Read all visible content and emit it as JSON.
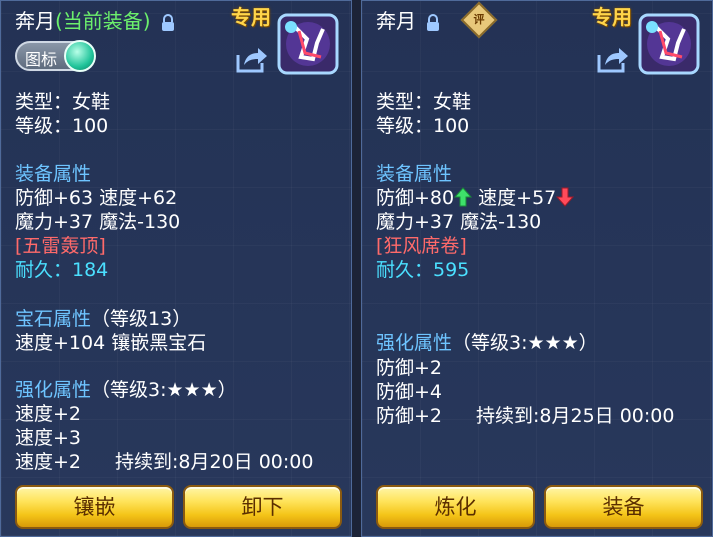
{
  "left": {
    "title": "奔月",
    "title_status": "(当前装备)",
    "exclusive": "专用",
    "toggle_label": "图标",
    "type": "类型：女鞋",
    "level": "等级：100",
    "equip_attr_title": "装备属性",
    "attr_line1": "防御+63 速度+62",
    "attr_line2": "魔力+37 魔法-130",
    "special": "[五雷轰顶]",
    "durability": "耐久：184",
    "gem_title": "宝石属性",
    "gem_level": "（等级13）",
    "gem_line": "速度+104 镶嵌黑宝石",
    "enhance_title": "强化属性",
    "enhance_level": "（等级3:★★★）",
    "enhance_lines": [
      "速度+2",
      "速度+3",
      "速度+2"
    ],
    "enhance_duration": "持续到:8月20日 00:00",
    "buttons": [
      "镶嵌",
      "卸下"
    ]
  },
  "right": {
    "title": "奔月",
    "rate_badge": "评",
    "exclusive": "专用",
    "type": "类型：女鞋",
    "level": "等级：100",
    "equip_attr_title": "装备属性",
    "attr_line1_a": "防御+80",
    "attr_line1_b": "速度+57",
    "attr_line2": "魔力+37 魔法-130",
    "special": "[狂风席卷]",
    "durability": "耐久：595",
    "enhance_title": "强化属性",
    "enhance_level": "（等级3:★★★）",
    "enhance_lines": [
      "防御+2",
      "防御+4",
      "防御+2"
    ],
    "enhance_duration": "持续到:8月25日 00:00",
    "buttons": [
      "炼化",
      "装备"
    ]
  },
  "colors": {
    "panel_bg": "#233255",
    "section_blue": "#6ec4ff",
    "special_red": "#ff6a6a",
    "durability_cyan": "#4be0ff",
    "equipped_green": "#6cf06c",
    "exclusive_gold": "#ffd54a",
    "button_gold": "#f4c418"
  },
  "icons": {
    "lock": "lock-icon",
    "share": "share-icon",
    "up": "arrow-up-icon",
    "down": "arrow-down-icon",
    "item": "boots-item-icon"
  }
}
